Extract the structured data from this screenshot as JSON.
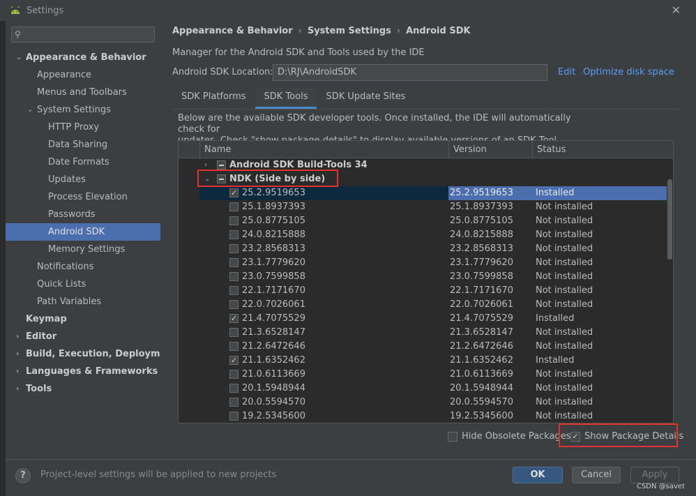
{
  "window": {
    "title": "Settings"
  },
  "search": {
    "placeholder": ""
  },
  "sidebar": {
    "items": [
      {
        "label": "Appearance & Behavior",
        "level": 0,
        "bold": true,
        "arrow": "down"
      },
      {
        "label": "Appearance",
        "level": 1
      },
      {
        "label": "Menus and Toolbars",
        "level": 1
      },
      {
        "label": "System Settings",
        "level": 1,
        "arrow": "down"
      },
      {
        "label": "HTTP Proxy",
        "level": 2
      },
      {
        "label": "Data Sharing",
        "level": 2
      },
      {
        "label": "Date Formats",
        "level": 2
      },
      {
        "label": "Updates",
        "level": 2
      },
      {
        "label": "Process Elevation",
        "level": 2
      },
      {
        "label": "Passwords",
        "level": 2
      },
      {
        "label": "Android SDK",
        "level": 2,
        "selected": true
      },
      {
        "label": "Memory Settings",
        "level": 2
      },
      {
        "label": "Notifications",
        "level": 1
      },
      {
        "label": "Quick Lists",
        "level": 1
      },
      {
        "label": "Path Variables",
        "level": 1
      },
      {
        "label": "Keymap",
        "level": 0,
        "bold": true
      },
      {
        "label": "Editor",
        "level": 0,
        "bold": true,
        "arrow": "right"
      },
      {
        "label": "Build, Execution, Deployment",
        "level": 0,
        "bold": true,
        "arrow": "right"
      },
      {
        "label": "Languages & Frameworks",
        "level": 0,
        "bold": true,
        "arrow": "right"
      },
      {
        "label": "Tools",
        "level": 0,
        "bold": true,
        "arrow": "right"
      }
    ]
  },
  "breadcrumb": {
    "part1": "Appearance & Behavior",
    "part2": "System Settings",
    "part3": "Android SDK"
  },
  "main": {
    "description": "Manager for the Android SDK and Tools used by the IDE",
    "location_label": "Android SDK Location:",
    "location_value": "D:\\RJ\\AndroidSDK",
    "edit_link": "Edit",
    "optimize_link": "Optimize disk space",
    "tabs": [
      {
        "label": "SDK Platforms"
      },
      {
        "label": "SDK Tools",
        "active": true
      },
      {
        "label": "SDK Update Sites"
      }
    ],
    "tools_desc_line1": "Below are the available SDK developer tools. Once installed, the IDE will automatically check for",
    "tools_desc_line2": "updates. Check \"show package details\" to display available versions of an SDK Tool."
  },
  "table": {
    "headers": {
      "name": "Name",
      "version": "Version",
      "status": "Status"
    },
    "groups": [
      {
        "label": "Android SDK Build-Tools 34",
        "expanded": false
      },
      {
        "label": "NDK (Side by side)",
        "expanded": true
      }
    ],
    "rows": [
      {
        "name": "25.2.9519653",
        "version": "25.2.9519653",
        "status": "Installed",
        "checked": true,
        "selected": true
      },
      {
        "name": "25.1.8937393",
        "version": "25.1.8937393",
        "status": "Not installed",
        "checked": false
      },
      {
        "name": "25.0.8775105",
        "version": "25.0.8775105",
        "status": "Not installed",
        "checked": false
      },
      {
        "name": "24.0.8215888",
        "version": "24.0.8215888",
        "status": "Not installed",
        "checked": false
      },
      {
        "name": "23.2.8568313",
        "version": "23.2.8568313",
        "status": "Not installed",
        "checked": false
      },
      {
        "name": "23.1.7779620",
        "version": "23.1.7779620",
        "status": "Not installed",
        "checked": false
      },
      {
        "name": "23.0.7599858",
        "version": "23.0.7599858",
        "status": "Not installed",
        "checked": false
      },
      {
        "name": "22.1.7171670",
        "version": "22.1.7171670",
        "status": "Not installed",
        "checked": false
      },
      {
        "name": "22.0.7026061",
        "version": "22.0.7026061",
        "status": "Not installed",
        "checked": false
      },
      {
        "name": "21.4.7075529",
        "version": "21.4.7075529",
        "status": "Installed",
        "checked": true
      },
      {
        "name": "21.3.6528147",
        "version": "21.3.6528147",
        "status": "Not installed",
        "checked": false
      },
      {
        "name": "21.2.6472646",
        "version": "21.2.6472646",
        "status": "Not installed",
        "checked": false
      },
      {
        "name": "21.1.6352462",
        "version": "21.1.6352462",
        "status": "Installed",
        "checked": true
      },
      {
        "name": "21.0.6113669",
        "version": "21.0.6113669",
        "status": "Not installed",
        "checked": false
      },
      {
        "name": "20.1.5948944",
        "version": "20.1.5948944",
        "status": "Not installed",
        "checked": false
      },
      {
        "name": "20.0.5594570",
        "version": "20.0.5594570",
        "status": "Not installed",
        "checked": false
      },
      {
        "name": "19.2.5345600",
        "version": "19.2.5345600",
        "status": "Not installed",
        "checked": false
      }
    ]
  },
  "options": {
    "hide_obsolete": {
      "label": "Hide Obsolete Packages",
      "checked": false
    },
    "show_details": {
      "label": "Show Package Details",
      "checked": true
    }
  },
  "footer": {
    "help": "?",
    "note": "Project-level settings will be applied to new projects",
    "ok": "OK",
    "cancel": "Cancel",
    "apply": "Apply"
  },
  "watermark": "CSDN @savet",
  "colors": {
    "accent": "#4b6eaf",
    "link": "#589df6",
    "highlight": "#e03030"
  }
}
